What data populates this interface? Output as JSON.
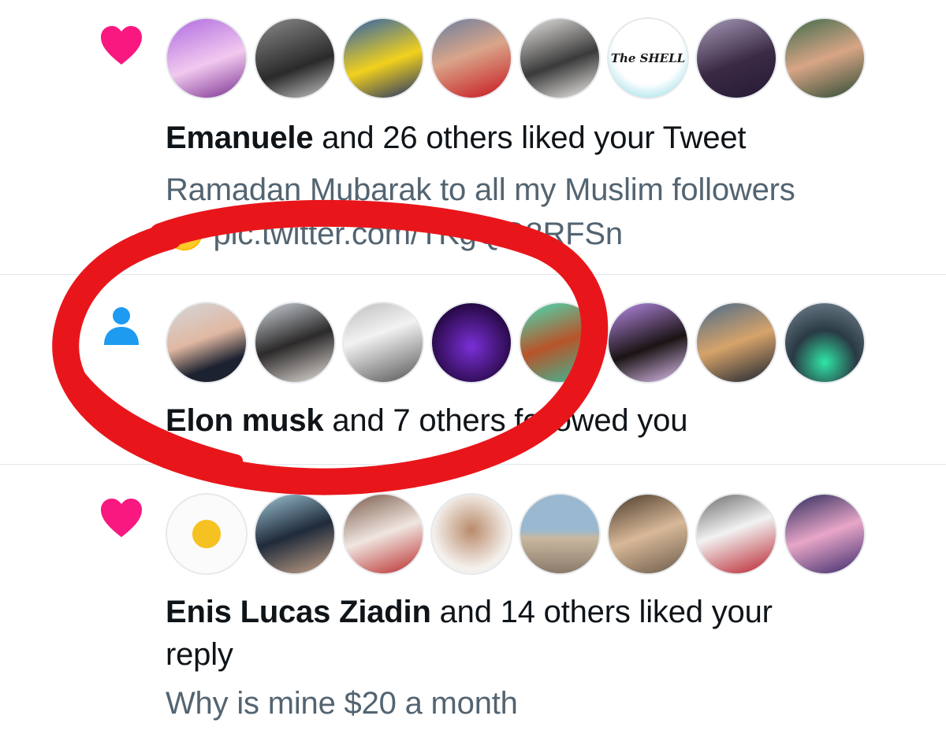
{
  "notifications": [
    {
      "type": "like",
      "icon": "heart-icon",
      "icon_color": "#f91880",
      "actor": "Emanuele",
      "action": " and 26 others liked your Tweet",
      "tweet_text_line1": "Ramadan Mubarak to all my Muslim followers",
      "tweet_text_line2": "🌙 pic.twitter.com/TKgQG8RFSn",
      "avatars": [
        {
          "name": "avatar-anime-character",
          "bg": "linear-gradient(160deg,#b06ae0,#f1c9ef 55%,#7a2f8f)"
        },
        {
          "name": "avatar-group-photo-bw",
          "bg": "linear-gradient(160deg,#8a8a8a,#2a2a2a 60%,#c9c9c9)"
        },
        {
          "name": "avatar-ronaldo-jersey",
          "bg": "linear-gradient(160deg,#2a5fb0,#f2d11c 55%,#1d2f6a)"
        },
        {
          "name": "avatar-footballer-red",
          "bg": "linear-gradient(160deg,#6a7e9e,#d9a58a 45%,#c8141c)"
        },
        {
          "name": "avatar-woman-hijab",
          "bg": "linear-gradient(160deg,#e8e5e2,#3a3a3a 55%,#f3f1ee)"
        },
        {
          "name": "avatar-the-shell-logo",
          "bg": "radial-gradient(circle at 50% 40%,#ffffff 55%,#79d3e0)",
          "label": "The SHELL"
        },
        {
          "name": "avatar-man-in-suit",
          "bg": "linear-gradient(160deg,#a69ab8,#3b2a44 55%,#241a36)"
        },
        {
          "name": "avatar-man-green",
          "bg": "linear-gradient(160deg,#3e6b4c,#d8a586 50%,#2b4a33)"
        }
      ]
    },
    {
      "type": "follow",
      "icon": "person-icon",
      "icon_color": "#1d9bf0",
      "actor": "Elon musk",
      "action": " and 7 others followed you",
      "avatars": [
        {
          "name": "avatar-elon-musk",
          "bg": "linear-gradient(160deg,#d4d6da,#e0b8a2 45%,#1c2230 75%)"
        },
        {
          "name": "avatar-woman-long-hair",
          "bg": "linear-gradient(160deg,#cfd5dc,#2c2a2a 50%,#e6e1dc)"
        },
        {
          "name": "avatar-woman-bw",
          "bg": "linear-gradient(160deg,#bdbdbd,#f2f2f2 40%,#555555)"
        },
        {
          "name": "avatar-purple-character",
          "bg": "radial-gradient(circle at 50% 55%,#7a2fd6,#2a0a4a 70%,#0a0a0a)"
        },
        {
          "name": "avatar-ape-green",
          "bg": "linear-gradient(160deg,#44e0b8,#b8542a 50%,#2fc2a0)"
        },
        {
          "name": "avatar-cartoon-sunglasses",
          "bg": "linear-gradient(160deg,#b98ae8,#1a1414 55%,#e4c4f6)"
        },
        {
          "name": "avatar-aviator-glasses",
          "bg": "linear-gradient(160deg,#4a6a8a,#d6a36a 50%,#1a2230)"
        },
        {
          "name": "avatar-robot-armor",
          "bg": "radial-gradient(circle at 50% 75%,#2fe6a6,#2a3a44 45%,#7a8a96)"
        }
      ]
    },
    {
      "type": "like",
      "icon": "heart-icon",
      "icon_color": "#f91880",
      "actor": "Enis Lucas Ziadin",
      "action": " and 14 others liked your",
      "action_line2": "reply",
      "tweet_text_line1": "Why is mine $20 a month",
      "avatars": [
        {
          "name": "avatar-chess-knight",
          "bg": "radial-gradient(circle at 50% 50%,#f6c221 0 25%,#fbfbfb 26%)"
        },
        {
          "name": "avatar-man-eating",
          "bg": "linear-gradient(160deg,#9ec6d6,#1f2a3a 50%,#c7a488)"
        },
        {
          "name": "avatar-man-pointing",
          "bg": "linear-gradient(160deg,#7a5a4a,#f0e6e0 50%,#b82a2a)"
        },
        {
          "name": "avatar-bearded-man-art",
          "bg": "radial-gradient(circle at 50% 45%,#b98a6a,#f4f0ec 65%)"
        },
        {
          "name": "avatar-beach",
          "bg": "linear-gradient(180deg,#9ab9d0 0 45%,#c9b8a0 55%,#8a7a6a)"
        },
        {
          "name": "avatar-man-lying",
          "bg": "linear-gradient(160deg,#4a3a2a,#d8b898 50%,#6a5a4a)"
        },
        {
          "name": "avatar-man-cap",
          "bg": "linear-gradient(160deg,#6a6a6a,#f2f2f2 45%,#b8202a)"
        },
        {
          "name": "avatar-woman-pink",
          "bg": "linear-gradient(160deg,#2a2a5a,#e8a6c8 50%,#3a2a6a)"
        }
      ]
    }
  ]
}
